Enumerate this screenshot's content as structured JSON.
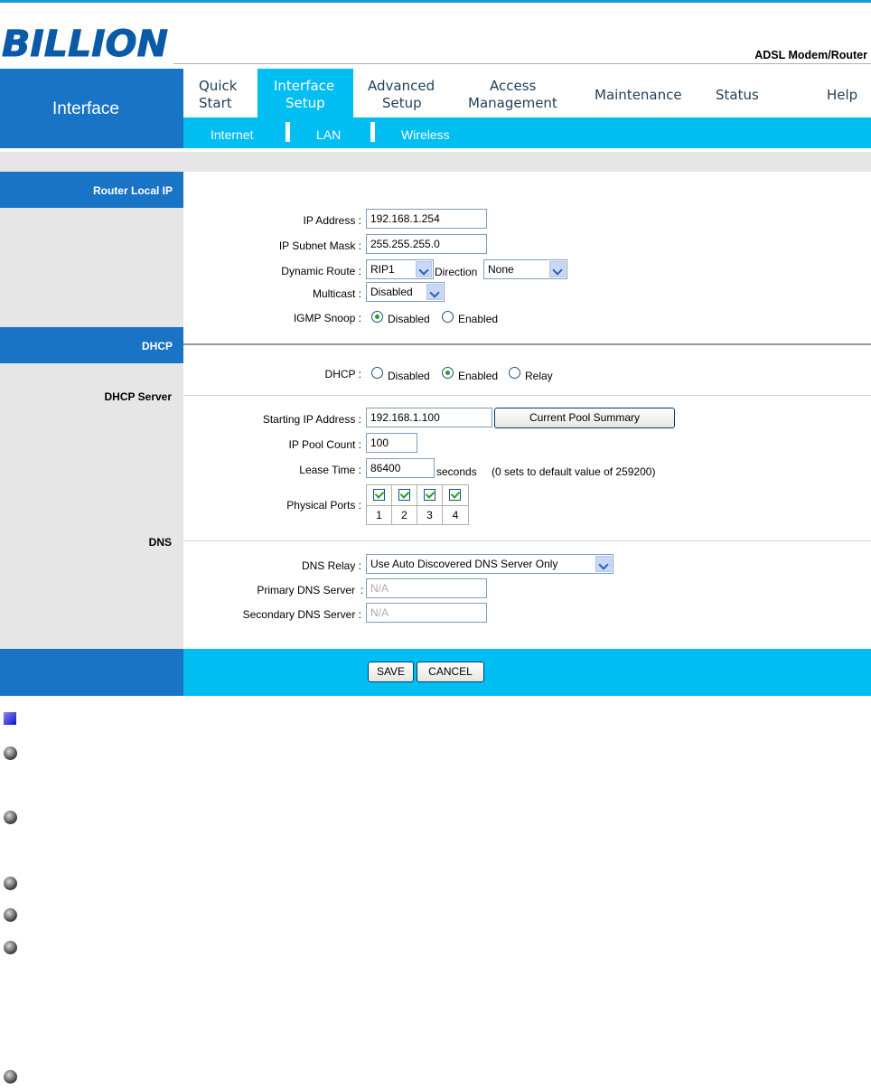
{
  "header": {
    "logo_text": "BILLION",
    "product": "ADSL Modem/Router"
  },
  "nav": {
    "section": "Interface",
    "tabs": [
      {
        "line1": "Quick",
        "line2": "Start"
      },
      {
        "line1": "Interface",
        "line2": "Setup"
      },
      {
        "line1": "Advanced",
        "line2": "Setup"
      },
      {
        "line1": "Access",
        "line2": "Management"
      },
      {
        "line1": "Maintenance",
        "line2": ""
      },
      {
        "line1": "Status",
        "line2": ""
      },
      {
        "line1": "Help",
        "line2": ""
      }
    ],
    "subtabs": [
      "Internet",
      "LAN",
      "Wireless"
    ]
  },
  "sections": {
    "router_local_ip": "Router Local IP",
    "dhcp": "DHCP",
    "dhcp_server": "DHCP Server",
    "dns": "DNS"
  },
  "router": {
    "ip_label": "IP Address :",
    "ip_value": "192.168.1.254",
    "mask_label": "IP Subnet Mask :",
    "mask_value": "255.255.255.0",
    "dynroute_label": "Dynamic Route :",
    "dynroute_value": "RIP1",
    "direction_label": "Direction",
    "direction_value": "None",
    "multicast_label": "Multicast :",
    "multicast_value": "Disabled",
    "igmp_label": "IGMP Snoop :",
    "igmp_options": [
      "Disabled",
      "Enabled"
    ],
    "igmp_selected": "Disabled"
  },
  "dhcp": {
    "label": "DHCP :",
    "options": [
      "Disabled",
      "Enabled",
      "Relay"
    ],
    "selected": "Enabled",
    "start_label": "Starting IP Address :",
    "start_value": "192.168.1.100",
    "pool_button": "Current Pool Summary",
    "count_label": "IP Pool Count :",
    "count_value": "100",
    "lease_label": "Lease Time :",
    "lease_value": "86400",
    "lease_unit": "seconds",
    "lease_note": "(0 sets to default value of 259200)",
    "ports_label": "Physical Ports :",
    "ports": [
      "1",
      "2",
      "3",
      "4"
    ],
    "ports_checked": [
      true,
      true,
      true,
      true
    ]
  },
  "dns": {
    "relay_label": "DNS Relay :",
    "relay_value": "Use Auto Discovered DNS Server Only",
    "primary_label": "Primary DNS Server",
    "primary_value": "N/A",
    "secondary_label": "Secondary DNS Server :",
    "secondary_value": "N/A"
  },
  "buttons": {
    "save": "SAVE",
    "cancel": "CANCEL"
  },
  "colors": {
    "nav_blue": "#1a74c6",
    "nav_cyan": "#00bdf2",
    "panel_gray": "#e6e6e6"
  }
}
